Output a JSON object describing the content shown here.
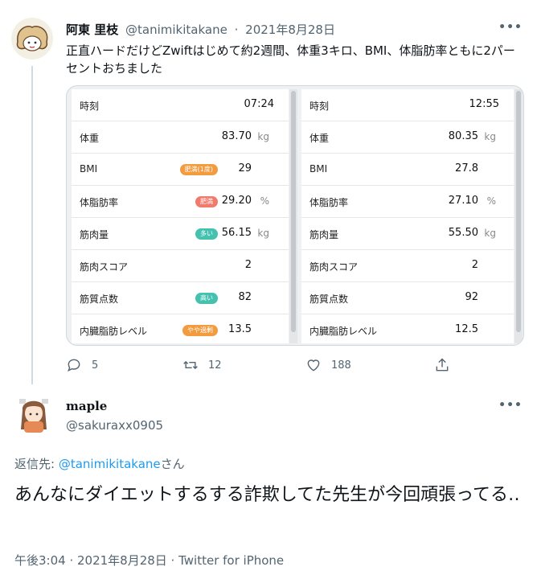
{
  "tweet": {
    "author_name": "阿東 里枝",
    "handle": "@tanimikitakane",
    "separator": "·",
    "date": "2021年8月28日",
    "text": "正直ハードだけどZwiftはじめて約2週間、体重3キロ、BMI、体脂肪率ともに2パーセントおちました",
    "more_icon": "more-dots-icon",
    "scale_left": [
      {
        "label": "時刻",
        "value": "07:24",
        "unit": "",
        "badge": ""
      },
      {
        "label": "体重",
        "value": "83.70",
        "unit": "kg",
        "badge": ""
      },
      {
        "label": "BMI",
        "value": "29",
        "unit": "",
        "badge": "肥満(1度)",
        "badge_color": "#f29b3f"
      },
      {
        "label": "体脂肪率",
        "value": "29.20",
        "unit": "%",
        "badge": "肥満",
        "badge_color": "#f07a6b"
      },
      {
        "label": "筋肉量",
        "value": "56.15",
        "unit": "kg",
        "badge": "多い",
        "badge_color": "#45c1b0"
      },
      {
        "label": "筋肉スコア",
        "value": "2",
        "unit": "",
        "badge": ""
      },
      {
        "label": "筋質点数",
        "value": "82",
        "unit": "",
        "badge": "高い",
        "badge_color": "#45c1b0"
      },
      {
        "label": "内臓脂肪レベル",
        "value": "13.5",
        "unit": "",
        "badge": "やや過剰",
        "badge_color": "#f29b3f"
      }
    ],
    "scale_right": [
      {
        "label": "時刻",
        "value": "12:55",
        "unit": ""
      },
      {
        "label": "体重",
        "value": "80.35",
        "unit": "kg"
      },
      {
        "label": "BMI",
        "value": "27.8",
        "unit": ""
      },
      {
        "label": "体脂肪率",
        "value": "27.10",
        "unit": "%"
      },
      {
        "label": "筋肉量",
        "value": "55.50",
        "unit": "kg"
      },
      {
        "label": "筋肉スコア",
        "value": "2",
        "unit": ""
      },
      {
        "label": "筋質点数",
        "value": "92",
        "unit": ""
      },
      {
        "label": "内臓脂肪レベル",
        "value": "12.5",
        "unit": ""
      }
    ],
    "actions": {
      "reply_count": "5",
      "retweet_count": "12",
      "like_count": "188"
    }
  },
  "reply": {
    "author_name": "maple",
    "handle": "@sakuraxx0905",
    "replying_prefix": "返信先: ",
    "replying_mention": "@tanimikitakane",
    "replying_suffix": "さん",
    "text": "あんなにダイエットするする詐欺してた先生が今回頑張ってる‥",
    "meta": "午後3:04 · 2021年8月28日 · Twitter for iPhone"
  },
  "colors": {
    "accent": "#1d9bf0",
    "secondary_text": "#536471"
  }
}
